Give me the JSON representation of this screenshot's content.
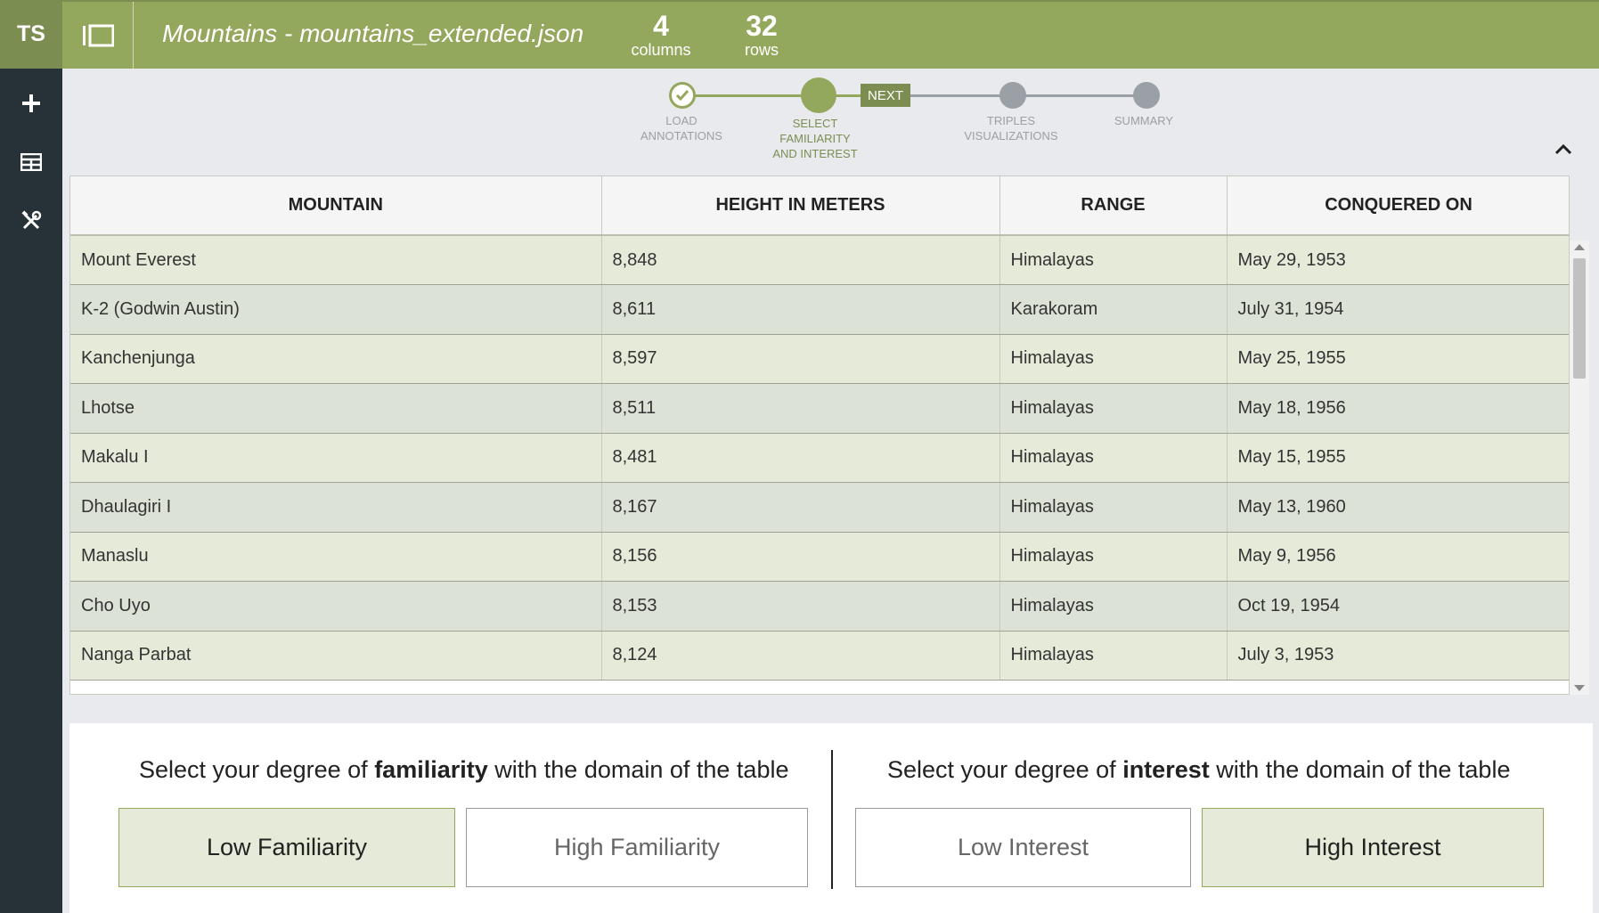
{
  "app": {
    "logo": "TS"
  },
  "sidebar": {
    "buttons": [
      {
        "icon": "plus-icon"
      },
      {
        "icon": "table-icon"
      },
      {
        "icon": "tools-icon"
      }
    ]
  },
  "header": {
    "title": "Mountains - mountains_extended.json",
    "columns_count": "4",
    "columns_label": "columns",
    "rows_count": "32",
    "rows_label": "rows"
  },
  "stepper": {
    "steps": [
      {
        "label_line1": "LOAD",
        "label_line2": "ANNOTATIONS",
        "label_line3": "",
        "state": "done"
      },
      {
        "label_line1": "SELECT",
        "label_line2": "FAMILIARITY",
        "label_line3": "AND INTEREST",
        "state": "current"
      },
      {
        "label_line1": "TRIPLES",
        "label_line2": "VISUALIZATIONS",
        "label_line3": "",
        "state": "pending"
      },
      {
        "label_line1": "SUMMARY",
        "label_line2": "",
        "label_line3": "",
        "state": "pending"
      }
    ],
    "next_label": "NEXT"
  },
  "table": {
    "headers": [
      "MOUNTAIN",
      "HEIGHT IN METERS",
      "RANGE",
      "CONQUERED ON"
    ],
    "rows": [
      [
        "Mount Everest",
        "8,848",
        "Himalayas",
        "May 29, 1953"
      ],
      [
        "K-2 (Godwin Austin)",
        "8,611",
        "Karakoram",
        "July 31, 1954"
      ],
      [
        "Kanchenjunga",
        "8,597",
        "Himalayas",
        "May 25, 1955"
      ],
      [
        "Lhotse",
        "8,511",
        "Himalayas",
        "May 18, 1956"
      ],
      [
        "Makalu I",
        "8,481",
        "Himalayas",
        "May 15, 1955"
      ],
      [
        "Dhaulagiri I",
        "8,167",
        "Himalayas",
        "May 13, 1960"
      ],
      [
        "Manaslu",
        "8,156",
        "Himalayas",
        "May 9, 1956"
      ],
      [
        "Cho Uyo",
        "8,153",
        "Himalayas",
        "Oct 19, 1954"
      ],
      [
        "Nanga Parbat",
        "8,124",
        "Himalayas",
        "July 3, 1953"
      ]
    ]
  },
  "familiarity": {
    "prompt_before": "Select your degree of",
    "prompt_bold": "familiarity",
    "prompt_after": "with the domain of the table",
    "low_label": "Low Familiarity",
    "high_label": "High Familiarity",
    "selected": "low"
  },
  "interest": {
    "prompt_before": "Select your degree of",
    "prompt_bold": "interest",
    "prompt_after": "with the domain of the table",
    "low_label": "Low Interest",
    "high_label": "High Interest",
    "selected": "high"
  },
  "colors": {
    "brand": "#94a85d",
    "brand_dark": "#7c8d52",
    "sidebar": "#263238",
    "pending": "#9aa0a6"
  }
}
